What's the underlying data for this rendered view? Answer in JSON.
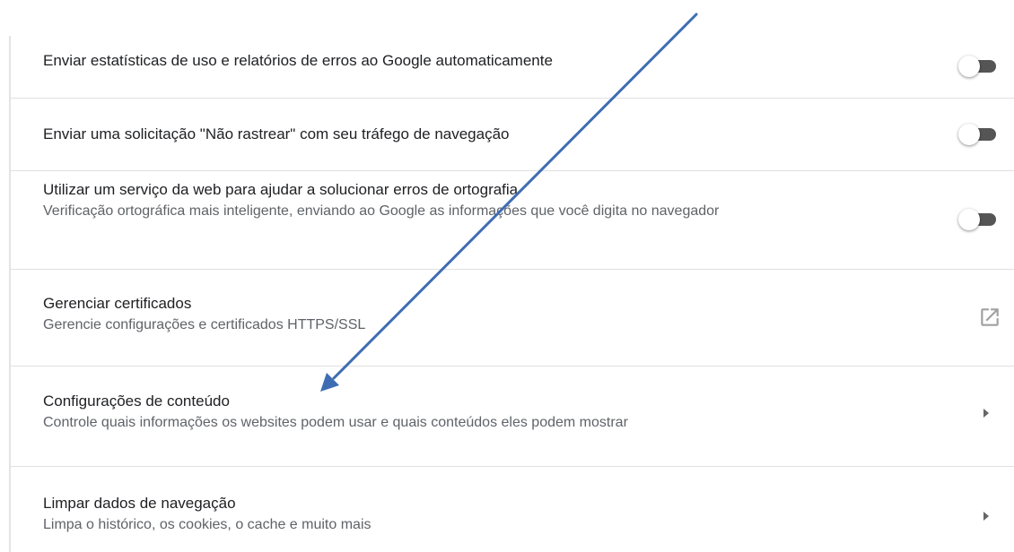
{
  "settings": {
    "rows": [
      {
        "title": "Enviar estatísticas de uso e relatórios de erros ao Google automaticamente",
        "control": "toggle",
        "enabled": false
      },
      {
        "title": "Enviar uma solicitação \"Não rastrear\" com seu tráfego de navegação",
        "control": "toggle",
        "enabled": false
      },
      {
        "title": "Utilizar um serviço da web para ajudar a solucionar erros de ortografia",
        "description": "Verificação ortográfica mais inteligente, enviando ao Google as informações que você digita no navegador",
        "control": "toggle",
        "enabled": false
      },
      {
        "title": "Gerenciar certificados",
        "description": "Gerencie configurações e certificados HTTPS/SSL",
        "control": "launch-icon"
      },
      {
        "title": "Configurações de conteúdo",
        "description": "Controle quais informações os websites podem usar e quais conteúdos eles podem mostrar",
        "control": "arrow-right-icon"
      },
      {
        "title": "Limpar dados de navegação",
        "description": "Limpa o histórico, os cookies, o cache e muito mais",
        "control": "arrow-right-icon"
      }
    ]
  },
  "annotation": {
    "shape": "arrow",
    "color": "#4472c4",
    "target": "Configurações de conteúdo"
  },
  "colors": {
    "toggle_track": "#555555",
    "toggle_knob": "#ffffff",
    "divider": "#e0e0e0",
    "primary_text": "#202124",
    "secondary_text": "#5f6368"
  }
}
